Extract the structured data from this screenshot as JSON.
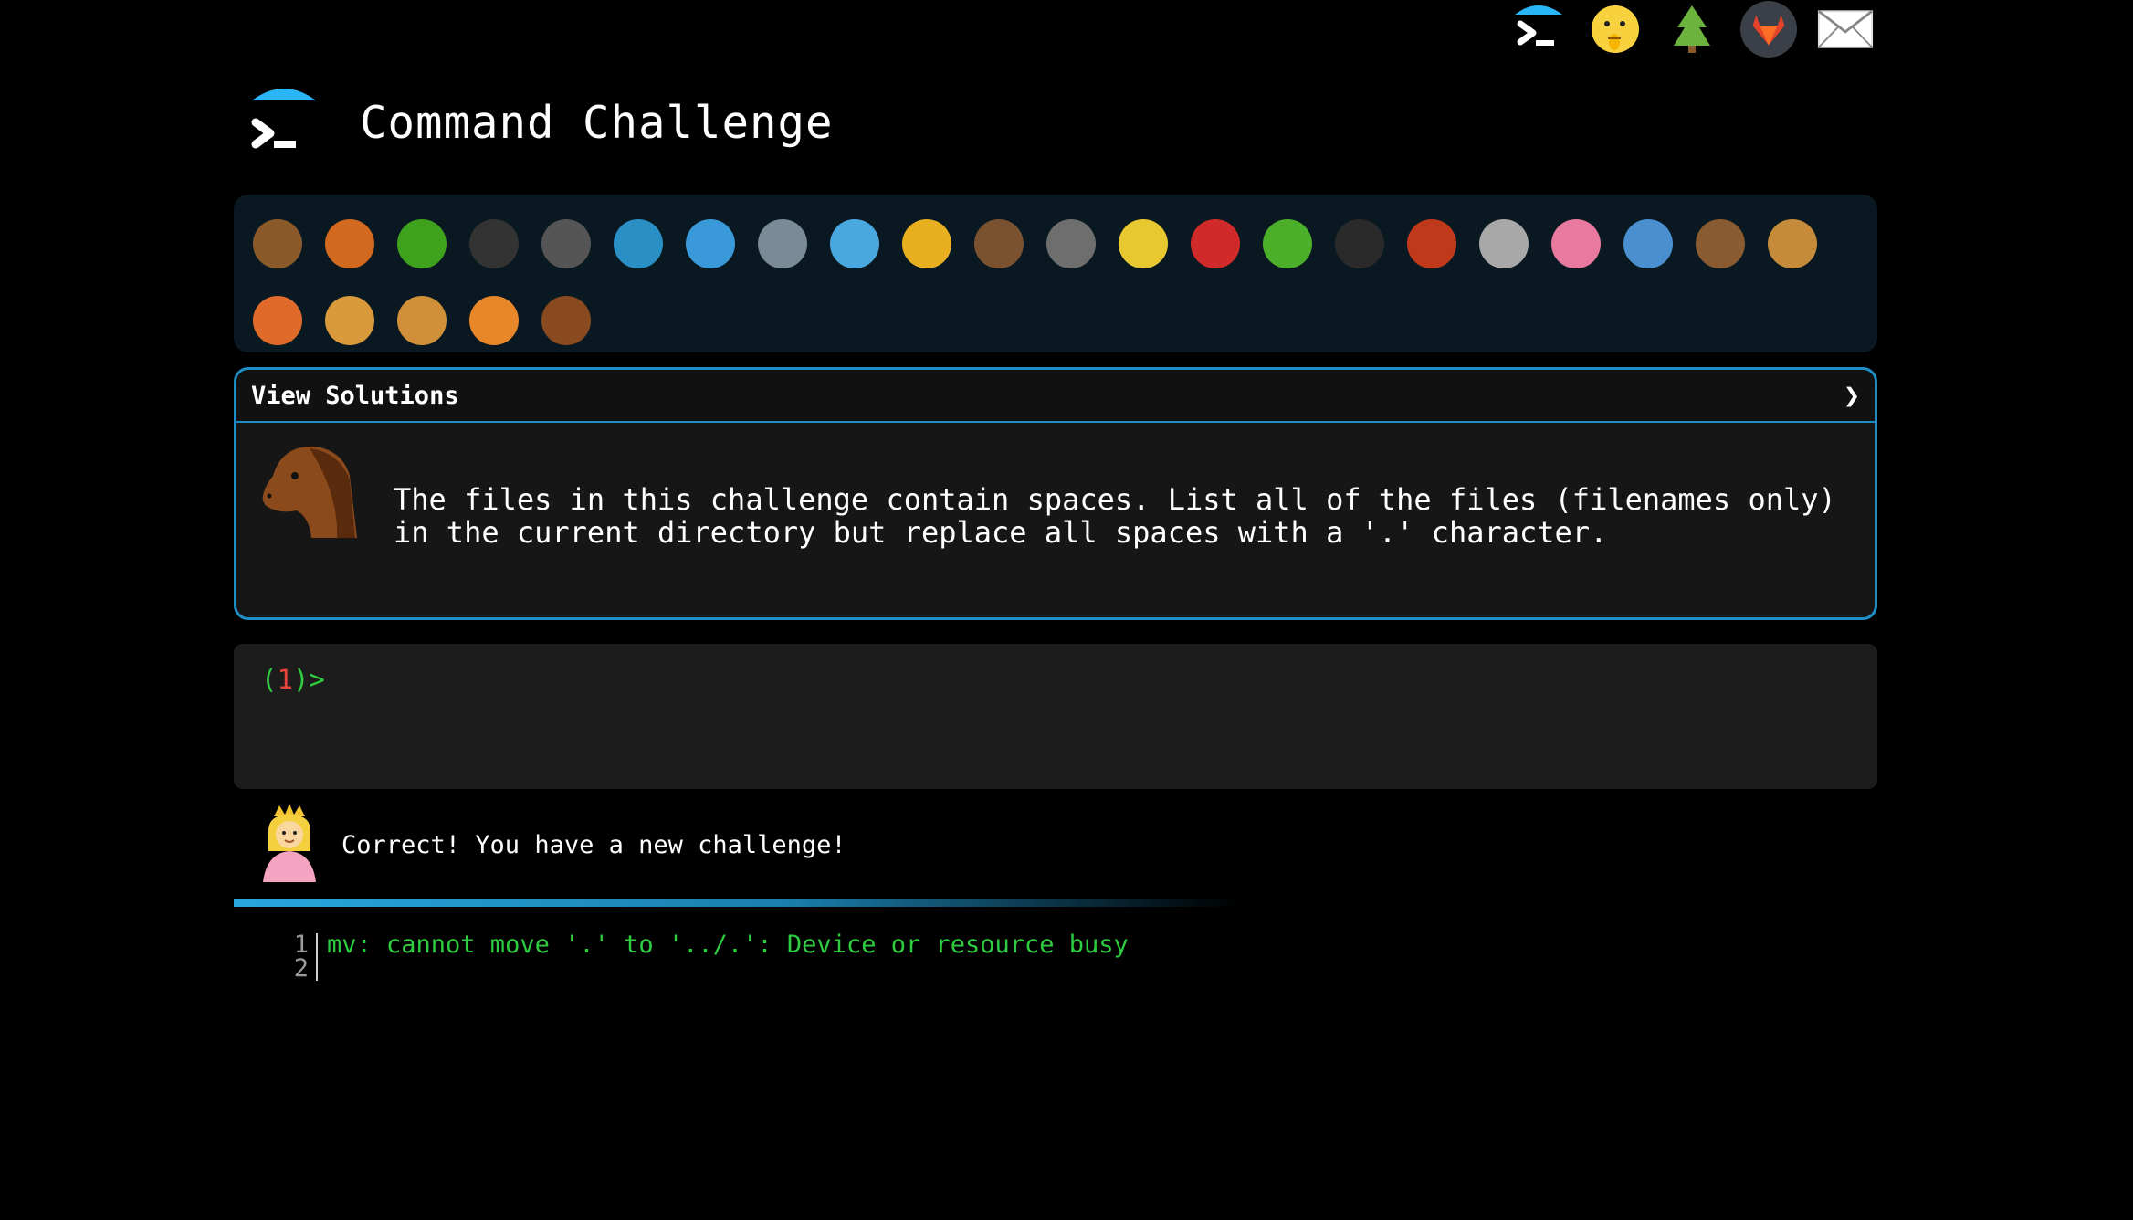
{
  "top_nav": {
    "icons": [
      {
        "name": "terminal-umbrella-icon"
      },
      {
        "name": "shushing-face-icon"
      },
      {
        "name": "tree-icon"
      },
      {
        "name": "gitlab-icon"
      },
      {
        "name": "mail-icon"
      }
    ]
  },
  "header": {
    "title": "Command Challenge"
  },
  "palette": {
    "animals": [
      {
        "name": "snail-icon",
        "color": "#8b5a2b"
      },
      {
        "name": "butterfly-icon",
        "color": "#d2691e"
      },
      {
        "name": "caterpillar-icon",
        "color": "#3fa21c"
      },
      {
        "name": "ant-icon",
        "color": "#333333"
      },
      {
        "name": "spider-web-icon",
        "color": "#555555"
      },
      {
        "name": "whale-icon",
        "color": "#2a8fc4"
      },
      {
        "name": "shark-icon",
        "color": "#3a9ad9"
      },
      {
        "name": "dolphin-icon",
        "color": "#7a8a96"
      },
      {
        "name": "fish-icon",
        "color": "#4aa8e0"
      },
      {
        "name": "tropical-fish-icon",
        "color": "#e8b020"
      },
      {
        "name": "hedgehog-icon",
        "color": "#7a5230"
      },
      {
        "name": "wolf-icon",
        "color": "#6e6e6e"
      },
      {
        "name": "bee-icon",
        "color": "#e8c830"
      },
      {
        "name": "ladybug-icon",
        "color": "#d02a2a"
      },
      {
        "name": "grasshopper-icon",
        "color": "#4caf2a"
      },
      {
        "name": "spider-icon",
        "color": "#2a2a2a"
      },
      {
        "name": "scorpion-icon",
        "color": "#c0391b"
      },
      {
        "name": "fly-icon",
        "color": "#a8a8a8"
      },
      {
        "name": "worm-icon",
        "color": "#e87aa0"
      },
      {
        "name": "microbe-icon",
        "color": "#4a8fd0"
      },
      {
        "name": "monkey-icon",
        "color": "#8a5a30"
      },
      {
        "name": "dog-icon",
        "color": "#c58a3a"
      },
      {
        "name": "fox-icon",
        "color": "#e06a2a"
      },
      {
        "name": "cat-icon",
        "color": "#d89a3a"
      },
      {
        "name": "lion-icon",
        "color": "#d0903a"
      },
      {
        "name": "tiger-icon",
        "color": "#e8862a"
      },
      {
        "name": "horse-icon",
        "color": "#8a4a20"
      }
    ]
  },
  "solutions": {
    "title": "View Solutions",
    "chevron": "❯",
    "challenge_text": "The files in this challenge contain spaces. List all of the files (filenames only) in the current directory but replace all spaces with a '.' character."
  },
  "terminal": {
    "prompt_open": "(",
    "prompt_num": "1",
    "prompt_close": ")>",
    "input_value": ""
  },
  "message": {
    "text": "Correct! You have a new challenge!"
  },
  "output": {
    "lines": [
      {
        "num": "1",
        "text": "mv: cannot move '.' to '../.': Device or resource busy"
      },
      {
        "num": "2",
        "text": ""
      }
    ]
  },
  "colors": {
    "accent": "#1f8ec4",
    "prompt_green": "#2ecc40",
    "prompt_red": "#e8443a",
    "panel_bg": "#0a1921"
  }
}
